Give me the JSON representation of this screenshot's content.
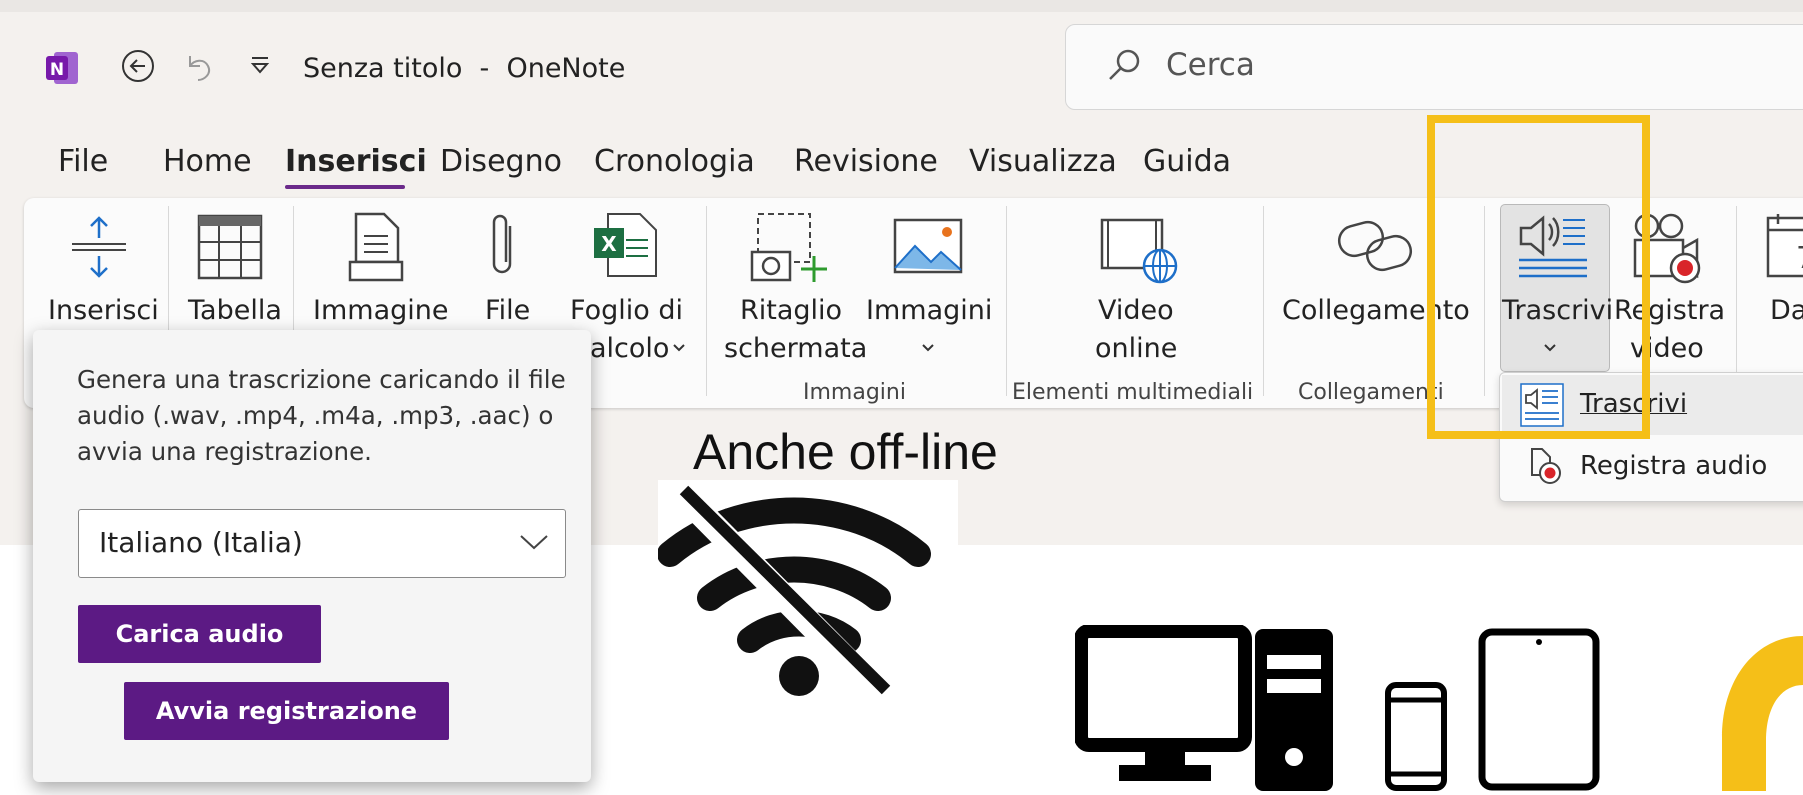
{
  "titlebar": {
    "title": "Senza titolo  -  OneNote",
    "app_icon_letter": "N",
    "search_placeholder": "Cerca",
    "icons": [
      "onenote-icon",
      "back-icon",
      "undo-icon",
      "customize-icon",
      "search-icon"
    ]
  },
  "tabs": [
    "File",
    "Home",
    "Inserisci",
    "Disegno",
    "Cronologia",
    "Revisione",
    "Visualizza",
    "Guida"
  ],
  "active_tab": "Inserisci",
  "ribbon": {
    "buttons": {
      "inserisci": "Inserisci",
      "tabella": "Tabella",
      "immagine": "Immagine",
      "file": "File",
      "foglio_line1": "Foglio di",
      "foglio_line2": "alcolo",
      "ritaglio_line1": "Ritaglio",
      "ritaglio_line2": "schermata",
      "immagini": "Immagini",
      "video_line1": "Video",
      "video_line2": "online",
      "collegamento": "Collegamento",
      "trascrivi": "Trascrivi",
      "registra_line1": "Registra",
      "registra_line2": "video",
      "data": "Da"
    },
    "groups": {
      "immagini": "Immagini",
      "multimediali": "Elementi multimediali",
      "collegamenti": "Collegamenti"
    }
  },
  "dropdown": {
    "item1": "Trascrivi",
    "item2": "Registra audio"
  },
  "transcribe_panel": {
    "description": "Genera una trascrizione caricando il file audio (.wav, .mp4, .m4a, .mp3, .aac) o avvia una registrazione.",
    "language": "Italiano (Italia)",
    "upload_button": "Carica audio",
    "record_button": "Avvia registrazione"
  },
  "canvas": {
    "offline_label": "Anche off-line"
  },
  "colors": {
    "accent": "#5c1a84",
    "highlight": "#f5bf18",
    "onenote": "#7719aa"
  }
}
